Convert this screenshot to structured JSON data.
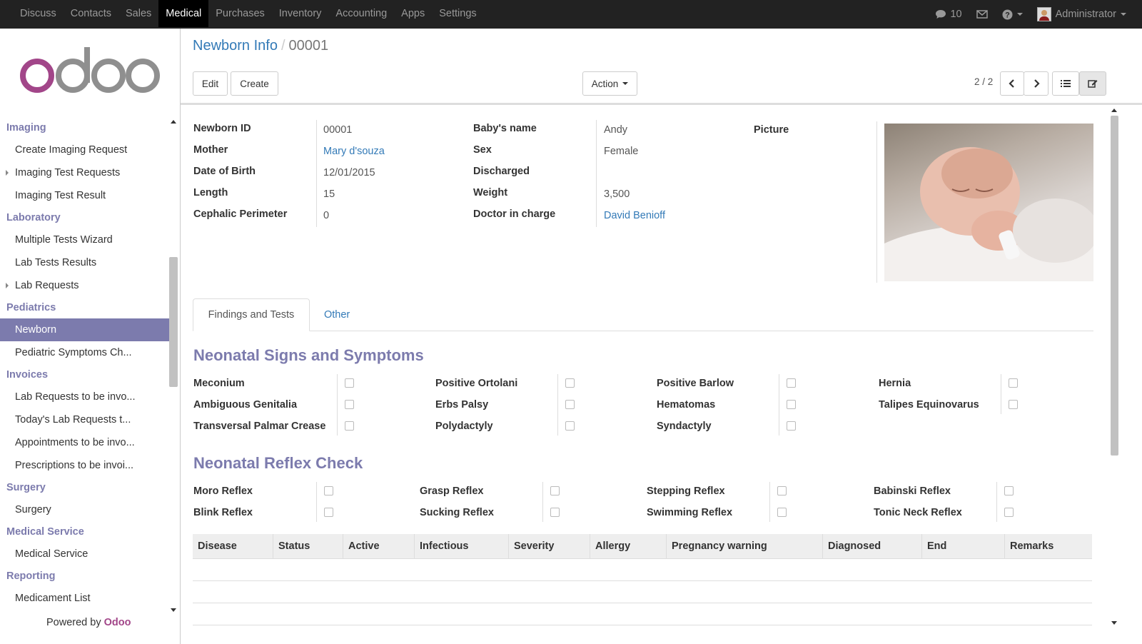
{
  "topbar": {
    "menu": [
      "Discuss",
      "Contacts",
      "Sales",
      "Medical",
      "Purchases",
      "Inventory",
      "Accounting",
      "Apps",
      "Settings"
    ],
    "active": "Medical",
    "messages_count": "10",
    "user": "Administrator"
  },
  "sidebar": {
    "sections": [
      {
        "title": "Imaging",
        "items": [
          {
            "label": "Create Imaging Request",
            "sub": false
          },
          {
            "label": "Imaging Test Requests",
            "sub": true
          },
          {
            "label": "Imaging Test Result",
            "sub": false
          }
        ]
      },
      {
        "title": "Laboratory",
        "items": [
          {
            "label": "Multiple Tests Wizard",
            "sub": false
          },
          {
            "label": "Lab Tests Results",
            "sub": false
          },
          {
            "label": "Lab Requests",
            "sub": true
          }
        ]
      },
      {
        "title": "Pediatrics",
        "items": [
          {
            "label": "Newborn",
            "sub": false,
            "active": true
          },
          {
            "label": "Pediatric Symptoms Ch...",
            "sub": false
          }
        ]
      },
      {
        "title": "Invoices",
        "items": [
          {
            "label": "Lab Requests to be invo...",
            "sub": false
          },
          {
            "label": "Today's Lab Requests t...",
            "sub": false
          },
          {
            "label": "Appointments to be invo...",
            "sub": false
          },
          {
            "label": "Prescriptions to be invoi...",
            "sub": false
          }
        ]
      },
      {
        "title": "Surgery",
        "items": [
          {
            "label": "Surgery",
            "sub": false
          }
        ]
      },
      {
        "title": "Medical Service",
        "items": [
          {
            "label": "Medical Service",
            "sub": false
          }
        ]
      },
      {
        "title": "Reporting",
        "items": [
          {
            "label": "Medicament List",
            "sub": false
          }
        ]
      }
    ],
    "powered_prefix": "Powered by",
    "powered_brand": "Odoo"
  },
  "breadcrumb": {
    "parent": "Newborn Info",
    "current": "00001"
  },
  "toolbar": {
    "edit": "Edit",
    "create": "Create",
    "action": "Action",
    "pager": "2 / 2"
  },
  "form": {
    "left_labels": [
      "Newborn ID",
      "Mother",
      "Date of Birth",
      "Length",
      "Cephalic Perimeter"
    ],
    "left_values": [
      "00001",
      "Mary d'souza",
      "12/01/2015",
      "15",
      "0"
    ],
    "mid_labels": [
      "Baby's name",
      "Sex",
      "Discharged",
      "Weight",
      "Doctor in charge"
    ],
    "mid_values": [
      "Andy",
      "Female",
      "",
      "3,500",
      "David Benioff"
    ],
    "picture_label": "Picture"
  },
  "tabs": {
    "findings": "Findings and Tests",
    "other": "Other"
  },
  "signs": {
    "title": "Neonatal Signs and Symptoms",
    "columns": [
      [
        "Meconium",
        "Ambiguous Genitalia",
        "Transversal Palmar Crease"
      ],
      [
        "Positive Ortolani",
        "Erbs Palsy",
        "Polydactyly"
      ],
      [
        "Positive Barlow",
        "Hematomas",
        "Syndactyly"
      ],
      [
        "Hernia",
        "Talipes Equinovarus"
      ]
    ]
  },
  "reflex": {
    "title": "Neonatal Reflex Check",
    "columns": [
      [
        "Moro Reflex",
        "Blink Reflex"
      ],
      [
        "Grasp Reflex",
        "Sucking Reflex"
      ],
      [
        "Stepping Reflex",
        "Swimming Reflex"
      ],
      [
        "Babinski Reflex",
        "Tonic Neck Reflex"
      ]
    ]
  },
  "table": {
    "headers": [
      "Disease",
      "Status",
      "Active",
      "Infectious",
      "Severity",
      "Allergy",
      "Pregnancy warning",
      "Diagnosed",
      "End",
      "Remarks"
    ]
  },
  "colors": {
    "accent": "#7c7bad",
    "link": "#337ab7",
    "topbar": "#222222",
    "brand": "#a24689"
  }
}
